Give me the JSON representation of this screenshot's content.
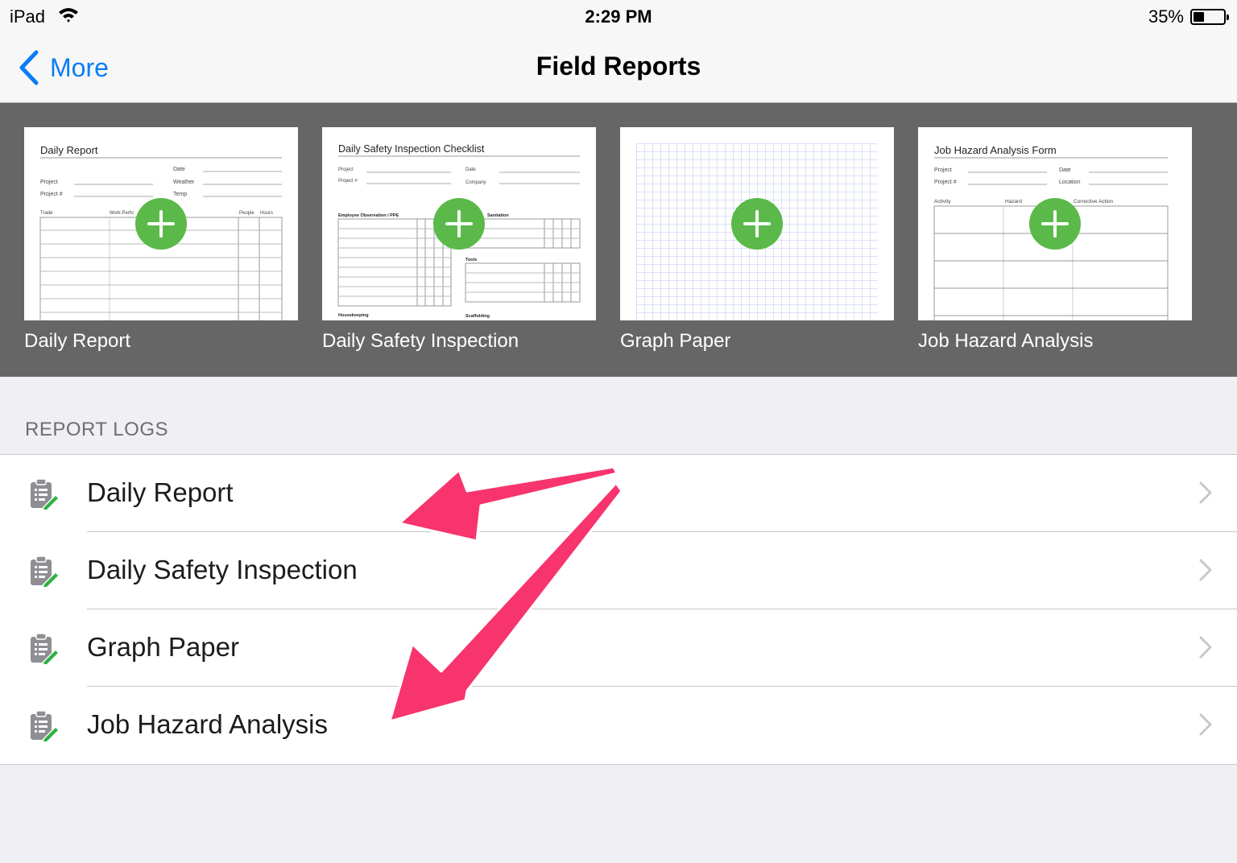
{
  "status": {
    "carrier": "iPad",
    "time": "2:29 PM",
    "battery": "35%",
    "battery_level": 0.35
  },
  "nav": {
    "back_label": "More",
    "title": "Field Reports"
  },
  "templates": [
    {
      "label": "Daily Report",
      "doc_title": "Daily Report",
      "fields": [
        "Project",
        "Project #",
        "Date",
        "Weather",
        "Temp"
      ],
      "columns": [
        "Trade",
        "Work Perfo",
        "People",
        "Hours"
      ]
    },
    {
      "label": "Daily Safety Inspection",
      "doc_title": "Daily Safety Inspection Checklist",
      "fields": [
        "Project",
        "Project #",
        "Date",
        "Company"
      ],
      "sections": [
        "Employee Observation / PPE",
        "Sanitation",
        "Tools",
        "Housekeeping",
        "Scaffolding"
      ]
    },
    {
      "label": "Graph Paper"
    },
    {
      "label": "Job Hazard Analysis",
      "doc_title": "Job Hazard Analysis Form",
      "fields": [
        "Project",
        "Project #",
        "Date",
        "Location"
      ],
      "columns": [
        "Activity",
        "Hazard",
        "Corrective Action"
      ]
    }
  ],
  "section_header": "REPORT LOGS",
  "logs": [
    {
      "label": "Daily Report"
    },
    {
      "label": "Daily Safety Inspection"
    },
    {
      "label": "Graph Paper"
    },
    {
      "label": "Job Hazard Analysis"
    }
  ],
  "colors": {
    "accent": "#0a7df5",
    "add_button": "#5bb94a",
    "strip_bg": "#666666",
    "annotation_arrow": "#f7346d"
  }
}
